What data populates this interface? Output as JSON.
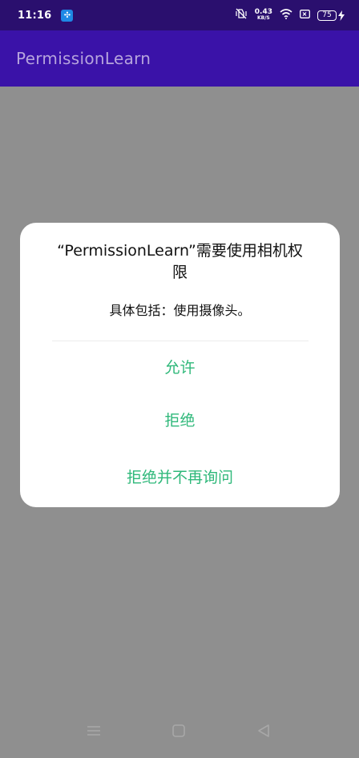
{
  "status_bar": {
    "time": "11:16",
    "net_speed_value": "0.43",
    "net_speed_unit": "KB/S",
    "battery_level": "75",
    "icons": [
      "notification-app-icon",
      "vibrate-off-icon",
      "wifi-icon",
      "screen-record-icon",
      "battery-icon",
      "charging-icon"
    ]
  },
  "app_bar": {
    "title": "PermissionLearn"
  },
  "dialog": {
    "title": "“PermissionLearn”需要使用相机权限",
    "message": "具体包括：使用摄像头。",
    "buttons": {
      "allow": "允许",
      "deny": "拒绝",
      "deny_forever": "拒绝并不再询问"
    },
    "button_color": "#2fb87a"
  },
  "nav_bar": {
    "icons": [
      "menu-icon",
      "home-icon",
      "back-icon"
    ]
  },
  "colors": {
    "status_bar": "#2a0f6e",
    "app_bar": "#3a12a8",
    "scrim": "#8f8f8f"
  }
}
